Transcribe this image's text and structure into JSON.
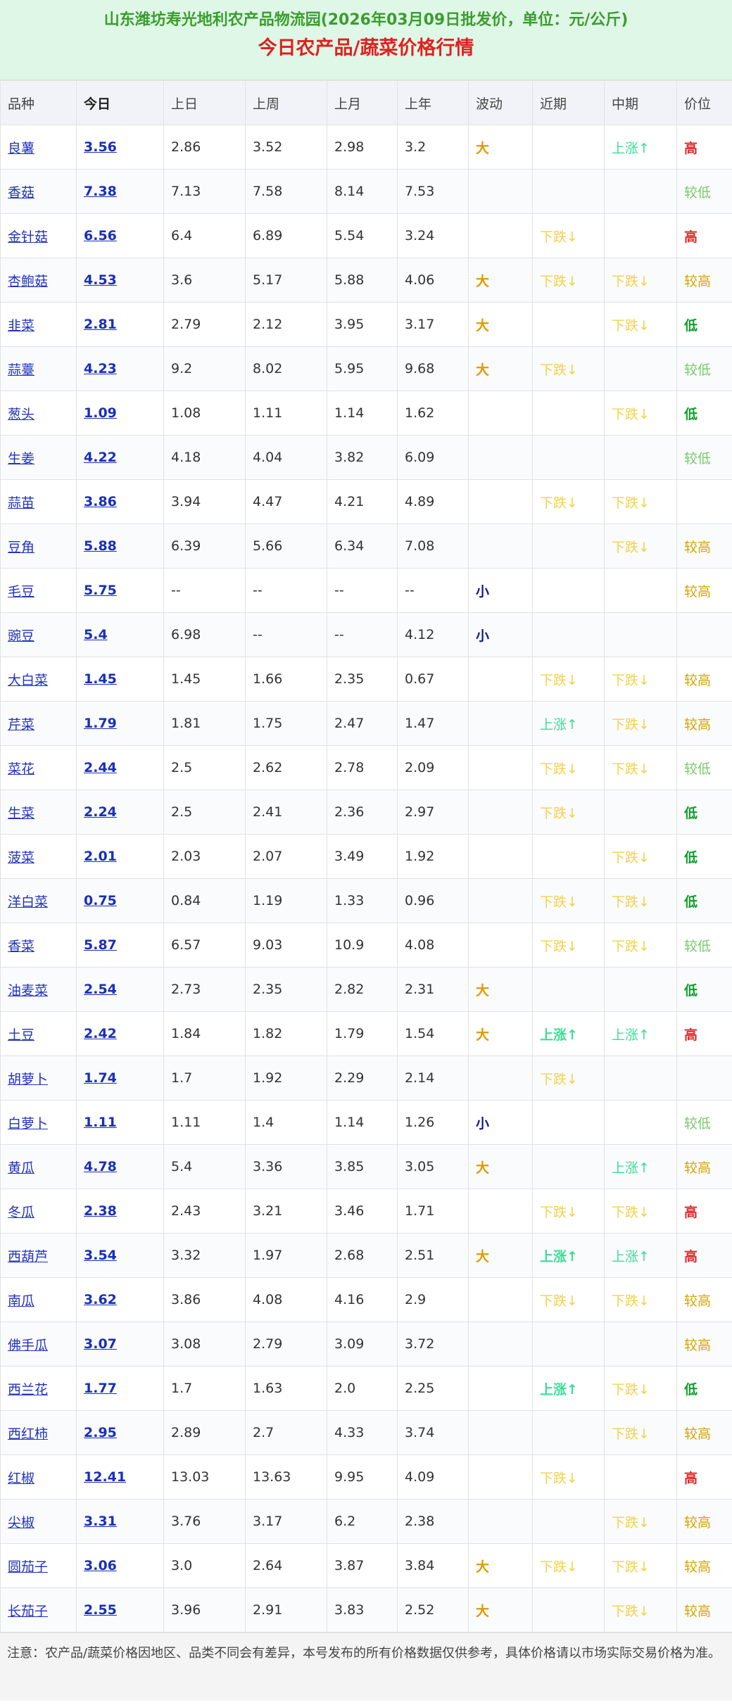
{
  "header": {
    "subtitle": "山东潍坊寿光地利农产品物流园(2026年03月09日批发价，单位：元/公斤)",
    "title": "今日农产品/蔬菜价格行情"
  },
  "columns": [
    "品种",
    "今日",
    "上日",
    "上周",
    "上月",
    "上年",
    "波动",
    "近期",
    "中期",
    "价位"
  ],
  "rows": [
    {
      "name": "良薯",
      "today": "3.56",
      "prev_day": "2.86",
      "prev_week": "3.52",
      "prev_month": "2.98",
      "prev_year": "3.2",
      "fluct": "大",
      "recent": "",
      "mid": "上涨↑",
      "level": "高",
      "recent_cls": "",
      "mid_cls": "up",
      "level_cls": "lvl-high"
    },
    {
      "name": "香菇",
      "today": "7.38",
      "prev_day": "7.13",
      "prev_week": "7.58",
      "prev_month": "8.14",
      "prev_year": "7.53",
      "fluct": "",
      "recent": "",
      "mid": "",
      "level": "较低",
      "recent_cls": "",
      "mid_cls": "",
      "level_cls": "lvl-mlow"
    },
    {
      "name": "金针菇",
      "today": "6.56",
      "prev_day": "6.4",
      "prev_week": "6.89",
      "prev_month": "5.54",
      "prev_year": "3.24",
      "fluct": "",
      "recent": "下跌↓",
      "mid": "",
      "level": "高",
      "recent_cls": "down",
      "mid_cls": "",
      "level_cls": "lvl-high"
    },
    {
      "name": "杏鲍菇",
      "today": "4.53",
      "prev_day": "3.6",
      "prev_week": "5.17",
      "prev_month": "5.88",
      "prev_year": "4.06",
      "fluct": "大",
      "recent": "下跌↓",
      "mid": "下跌↓",
      "level": "较高",
      "recent_cls": "down",
      "mid_cls": "down",
      "level_cls": "lvl-mhigh"
    },
    {
      "name": "韭菜",
      "today": "2.81",
      "prev_day": "2.79",
      "prev_week": "2.12",
      "prev_month": "3.95",
      "prev_year": "3.17",
      "fluct": "大",
      "recent": "",
      "mid": "下跌↓",
      "level": "低",
      "recent_cls": "",
      "mid_cls": "down",
      "level_cls": "lvl-low"
    },
    {
      "name": "蒜薹",
      "today": "4.23",
      "prev_day": "9.2",
      "prev_week": "8.02",
      "prev_month": "5.95",
      "prev_year": "9.68",
      "fluct": "大",
      "recent": "下跌↓",
      "mid": "",
      "level": "较低",
      "recent_cls": "down",
      "mid_cls": "",
      "level_cls": "lvl-mlow"
    },
    {
      "name": "葱头",
      "today": "1.09",
      "prev_day": "1.08",
      "prev_week": "1.11",
      "prev_month": "1.14",
      "prev_year": "1.62",
      "fluct": "",
      "recent": "",
      "mid": "下跌↓",
      "level": "低",
      "recent_cls": "",
      "mid_cls": "down",
      "level_cls": "lvl-low"
    },
    {
      "name": "生姜",
      "today": "4.22",
      "prev_day": "4.18",
      "prev_week": "4.04",
      "prev_month": "3.82",
      "prev_year": "6.09",
      "fluct": "",
      "recent": "",
      "mid": "",
      "level": "较低",
      "recent_cls": "",
      "mid_cls": "",
      "level_cls": "lvl-mlow"
    },
    {
      "name": "蒜苗",
      "today": "3.86",
      "prev_day": "3.94",
      "prev_week": "4.47",
      "prev_month": "4.21",
      "prev_year": "4.89",
      "fluct": "",
      "recent": "下跌↓",
      "mid": "下跌↓",
      "level": "",
      "recent_cls": "down",
      "mid_cls": "down",
      "level_cls": ""
    },
    {
      "name": "豆角",
      "today": "5.88",
      "prev_day": "6.39",
      "prev_week": "5.66",
      "prev_month": "6.34",
      "prev_year": "7.08",
      "fluct": "",
      "recent": "",
      "mid": "下跌↓",
      "level": "较高",
      "recent_cls": "",
      "mid_cls": "down",
      "level_cls": "lvl-mhigh"
    },
    {
      "name": "毛豆",
      "today": "5.75",
      "prev_day": "--",
      "prev_week": "--",
      "prev_month": "--",
      "prev_year": "--",
      "fluct": "小",
      "recent": "",
      "mid": "",
      "level": "较高",
      "recent_cls": "",
      "mid_cls": "",
      "level_cls": "lvl-mhigh"
    },
    {
      "name": "豌豆",
      "today": "5.4",
      "prev_day": "6.98",
      "prev_week": "--",
      "prev_month": "--",
      "prev_year": "4.12",
      "fluct": "小",
      "recent": "",
      "mid": "",
      "level": "",
      "recent_cls": "",
      "mid_cls": "",
      "level_cls": ""
    },
    {
      "name": "大白菜",
      "today": "1.45",
      "prev_day": "1.45",
      "prev_week": "1.66",
      "prev_month": "2.35",
      "prev_year": "0.67",
      "fluct": "",
      "recent": "下跌↓",
      "mid": "下跌↓",
      "level": "较高",
      "recent_cls": "down",
      "mid_cls": "down",
      "level_cls": "lvl-mhigh"
    },
    {
      "name": "芹菜",
      "today": "1.79",
      "prev_day": "1.81",
      "prev_week": "1.75",
      "prev_month": "2.47",
      "prev_year": "1.47",
      "fluct": "",
      "recent": "上涨↑",
      "mid": "下跌↓",
      "level": "较高",
      "recent_cls": "up",
      "mid_cls": "down",
      "level_cls": "lvl-mhigh"
    },
    {
      "name": "菜花",
      "today": "2.44",
      "prev_day": "2.5",
      "prev_week": "2.62",
      "prev_month": "2.78",
      "prev_year": "2.09",
      "fluct": "",
      "recent": "下跌↓",
      "mid": "下跌↓",
      "level": "较低",
      "recent_cls": "down",
      "mid_cls": "down",
      "level_cls": "lvl-mlow"
    },
    {
      "name": "生菜",
      "today": "2.24",
      "prev_day": "2.5",
      "prev_week": "2.41",
      "prev_month": "2.36",
      "prev_year": "2.97",
      "fluct": "",
      "recent": "下跌↓",
      "mid": "",
      "level": "低",
      "recent_cls": "down",
      "mid_cls": "",
      "level_cls": "lvl-low"
    },
    {
      "name": "菠菜",
      "today": "2.01",
      "prev_day": "2.03",
      "prev_week": "2.07",
      "prev_month": "3.49",
      "prev_year": "1.92",
      "fluct": "",
      "recent": "",
      "mid": "下跌↓",
      "level": "低",
      "recent_cls": "",
      "mid_cls": "down",
      "level_cls": "lvl-low"
    },
    {
      "name": "洋白菜",
      "today": "0.75",
      "prev_day": "0.84",
      "prev_week": "1.19",
      "prev_month": "1.33",
      "prev_year": "0.96",
      "fluct": "",
      "recent": "下跌↓",
      "mid": "下跌↓",
      "level": "低",
      "recent_cls": "down",
      "mid_cls": "down",
      "level_cls": "lvl-low"
    },
    {
      "name": "香菜",
      "today": "5.87",
      "prev_day": "6.57",
      "prev_week": "9.03",
      "prev_month": "10.9",
      "prev_year": "4.08",
      "fluct": "",
      "recent": "下跌↓",
      "mid": "下跌↓",
      "level": "较低",
      "recent_cls": "down",
      "mid_cls": "down",
      "level_cls": "lvl-mlow"
    },
    {
      "name": "油麦菜",
      "today": "2.54",
      "prev_day": "2.73",
      "prev_week": "2.35",
      "prev_month": "2.82",
      "prev_year": "2.31",
      "fluct": "大",
      "recent": "",
      "mid": "",
      "level": "低",
      "recent_cls": "",
      "mid_cls": "",
      "level_cls": "lvl-low"
    },
    {
      "name": "土豆",
      "today": "2.42",
      "prev_day": "1.84",
      "prev_week": "1.82",
      "prev_month": "1.79",
      "prev_year": "1.54",
      "fluct": "大",
      "recent": "上涨↑",
      "mid": "上涨↑",
      "level": "高",
      "recent_cls": "up bold",
      "mid_cls": "up",
      "level_cls": "lvl-high"
    },
    {
      "name": "胡萝卜",
      "today": "1.74",
      "prev_day": "1.7",
      "prev_week": "1.92",
      "prev_month": "2.29",
      "prev_year": "2.14",
      "fluct": "",
      "recent": "下跌↓",
      "mid": "",
      "level": "",
      "recent_cls": "down",
      "mid_cls": "",
      "level_cls": ""
    },
    {
      "name": "白萝卜",
      "today": "1.11",
      "prev_day": "1.11",
      "prev_week": "1.4",
      "prev_month": "1.14",
      "prev_year": "1.26",
      "fluct": "小",
      "recent": "",
      "mid": "",
      "level": "较低",
      "recent_cls": "",
      "mid_cls": "",
      "level_cls": "lvl-mlow"
    },
    {
      "name": "黄瓜",
      "today": "4.78",
      "prev_day": "5.4",
      "prev_week": "3.36",
      "prev_month": "3.85",
      "prev_year": "3.05",
      "fluct": "大",
      "recent": "",
      "mid": "上涨↑",
      "level": "较高",
      "recent_cls": "",
      "mid_cls": "up",
      "level_cls": "lvl-mhigh"
    },
    {
      "name": "冬瓜",
      "today": "2.38",
      "prev_day": "2.43",
      "prev_week": "3.21",
      "prev_month": "3.46",
      "prev_year": "1.71",
      "fluct": "",
      "recent": "下跌↓",
      "mid": "下跌↓",
      "level": "高",
      "recent_cls": "down",
      "mid_cls": "down",
      "level_cls": "lvl-high"
    },
    {
      "name": "西葫芦",
      "today": "3.54",
      "prev_day": "3.32",
      "prev_week": "1.97",
      "prev_month": "2.68",
      "prev_year": "2.51",
      "fluct": "大",
      "recent": "上涨↑",
      "mid": "上涨↑",
      "level": "高",
      "recent_cls": "up bold",
      "mid_cls": "up",
      "level_cls": "lvl-high"
    },
    {
      "name": "南瓜",
      "today": "3.62",
      "prev_day": "3.86",
      "prev_week": "4.08",
      "prev_month": "4.16",
      "prev_year": "2.9",
      "fluct": "",
      "recent": "下跌↓",
      "mid": "下跌↓",
      "level": "较高",
      "recent_cls": "down",
      "mid_cls": "down",
      "level_cls": "lvl-mhigh"
    },
    {
      "name": "佛手瓜",
      "today": "3.07",
      "prev_day": "3.08",
      "prev_week": "2.79",
      "prev_month": "3.09",
      "prev_year": "3.72",
      "fluct": "",
      "recent": "",
      "mid": "",
      "level": "较高",
      "recent_cls": "",
      "mid_cls": "",
      "level_cls": "lvl-mhigh"
    },
    {
      "name": "西兰花",
      "today": "1.77",
      "prev_day": "1.7",
      "prev_week": "1.63",
      "prev_month": "2.0",
      "prev_year": "2.25",
      "fluct": "",
      "recent": "上涨↑",
      "mid": "下跌↓",
      "level": "低",
      "recent_cls": "up bold",
      "mid_cls": "down",
      "level_cls": "lvl-low"
    },
    {
      "name": "西红柿",
      "today": "2.95",
      "prev_day": "2.89",
      "prev_week": "2.7",
      "prev_month": "4.33",
      "prev_year": "3.74",
      "fluct": "",
      "recent": "",
      "mid": "下跌↓",
      "level": "较高",
      "recent_cls": "",
      "mid_cls": "down",
      "level_cls": "lvl-mhigh"
    },
    {
      "name": "红椒",
      "today": "12.41",
      "prev_day": "13.03",
      "prev_week": "13.63",
      "prev_month": "9.95",
      "prev_year": "4.09",
      "fluct": "",
      "recent": "下跌↓",
      "mid": "",
      "level": "高",
      "recent_cls": "down",
      "mid_cls": "",
      "level_cls": "lvl-high"
    },
    {
      "name": "尖椒",
      "today": "3.31",
      "prev_day": "3.76",
      "prev_week": "3.17",
      "prev_month": "6.2",
      "prev_year": "2.38",
      "fluct": "",
      "recent": "",
      "mid": "下跌↓",
      "level": "较高",
      "recent_cls": "",
      "mid_cls": "down",
      "level_cls": "lvl-mhigh"
    },
    {
      "name": "圆茄子",
      "today": "3.06",
      "prev_day": "3.0",
      "prev_week": "2.64",
      "prev_month": "3.87",
      "prev_year": "3.84",
      "fluct": "大",
      "recent": "下跌↓",
      "mid": "下跌↓",
      "level": "较高",
      "recent_cls": "down",
      "mid_cls": "down",
      "level_cls": "lvl-mhigh"
    },
    {
      "name": "长茄子",
      "today": "2.55",
      "prev_day": "3.96",
      "prev_week": "2.91",
      "prev_month": "3.83",
      "prev_year": "2.52",
      "fluct": "大",
      "recent": "",
      "mid": "下跌↓",
      "level": "较高",
      "recent_cls": "",
      "mid_cls": "down",
      "level_cls": "lvl-mhigh"
    }
  ],
  "note": "注意：农产品/蔬菜价格因地区、品类不同会有差异，本号发布的所有价格数据仅供参考，具体价格请以市场实际交易价格为准。"
}
